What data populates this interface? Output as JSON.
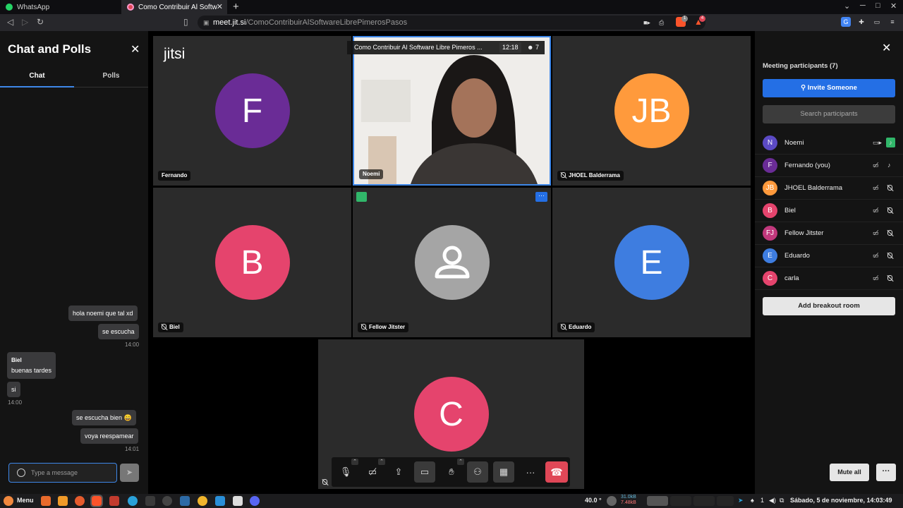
{
  "browser": {
    "tabs": [
      {
        "label": "WhatsApp"
      },
      {
        "label": "Como Contribuir Al Software Libre Pimeros Pasos"
      }
    ],
    "url_domain": "meet.jit.si",
    "url_path": "/ComoContribuirAlSoftwareLibrePimerosPasos",
    "new_tab": "+",
    "brave_badge": "1",
    "rewards_badge": "4"
  },
  "chat": {
    "title": "Chat and Polls",
    "tabs": [
      "Chat",
      "Polls"
    ],
    "messages": [
      {
        "text": "hola noemi que tal xd"
      },
      {
        "text": "se escucha"
      },
      {
        "time": "14:00"
      },
      {
        "sender": "Biel",
        "text": "buenas tardes"
      },
      {
        "text": "si"
      },
      {
        "time": "14:00"
      },
      {
        "text": "se escucha bien 😄"
      },
      {
        "text": "voya reespamear"
      },
      {
        "time": "14:01"
      }
    ],
    "placeholder": "Type a message"
  },
  "meeting": {
    "logo": "jitsi",
    "title": "Como Contribuir Al Software Libre Pimeros ...",
    "elapsed": "12:18",
    "participant_count": "7",
    "tiles": [
      {
        "name": "Fernando",
        "initials": "F",
        "color": "#6a2c96"
      },
      {
        "name": "Noemi",
        "initials": "",
        "color": "#e7e7e7"
      },
      {
        "name": "JHOEL Balderrama",
        "initials": "JB",
        "color": "#ff9a3c"
      },
      {
        "name": "Biel",
        "initials": "B",
        "color": "#e5446d"
      },
      {
        "name": "Fellow Jitster",
        "initials": "",
        "color": "#a5a5a5"
      },
      {
        "name": "Eduardo",
        "initials": "E",
        "color": "#3e7de0"
      },
      {
        "name": "carla",
        "initials": "C",
        "color": "#e5446d"
      }
    ]
  },
  "participants": {
    "title": "Meeting participants (7)",
    "invite_label": "Invite Someone",
    "search_placeholder": "Search participants",
    "list": [
      {
        "name": "Noemi",
        "initials": "N",
        "color": "#5b4ac4"
      },
      {
        "name": "Fernando (you)",
        "initials": "F",
        "color": "#6a2c96"
      },
      {
        "name": "JHOEL Balderrama",
        "initials": "JB",
        "color": "#ff9a3c"
      },
      {
        "name": "Biel",
        "initials": "B",
        "color": "#e5446d"
      },
      {
        "name": "Fellow Jitster",
        "initials": "FJ",
        "color": "#c1387c"
      },
      {
        "name": "Eduardo",
        "initials": "E",
        "color": "#3e7de0"
      },
      {
        "name": "carla",
        "initials": "C",
        "color": "#e5446d"
      }
    ],
    "breakout_label": "Add breakout room",
    "mute_all_label": "Mute all",
    "more_label": "···"
  },
  "taskbar": {
    "menu_label": "Menu",
    "temperature": "40.0 °",
    "net_down": "31.0kB",
    "net_up": "7.48kB",
    "clock": "Sábado,  5 de noviembre, 14:03:49",
    "tray_count": "1"
  }
}
